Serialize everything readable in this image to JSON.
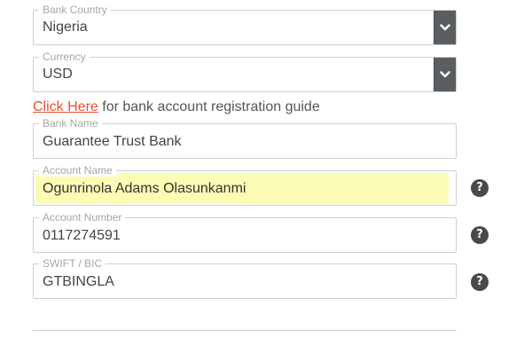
{
  "bank_country": {
    "label": "Bank Country",
    "value": "Nigeria"
  },
  "currency": {
    "label": "Currency",
    "value": "USD"
  },
  "guide": {
    "link_text": "Click Here",
    "text": " for bank account registration guide"
  },
  "bank_name": {
    "label": "Bank Name",
    "value": "Guarantee Trust Bank"
  },
  "account_name": {
    "label": "Account Name",
    "value": "Ogunrinola Adams Olasunkanmi"
  },
  "account_number": {
    "label": "Account Number",
    "value": "0117274591"
  },
  "swift_bic": {
    "label": "SWIFT / BIC",
    "value": "GTBINGLA"
  },
  "help_glyph": "?",
  "icons": {
    "dropdown": "chevron-down-icon",
    "help": "question-circle-icon"
  },
  "colors": {
    "link": "#e5502f",
    "highlight": "#fcfcb5",
    "select_button": "#595e61"
  }
}
